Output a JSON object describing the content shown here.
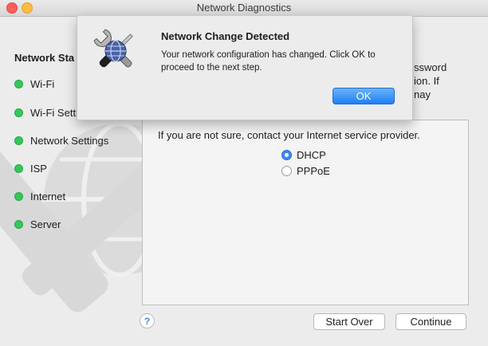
{
  "window": {
    "title": "Network Diagnostics"
  },
  "sidebar": {
    "heading": "Network Sta",
    "steps": [
      {
        "label": "Wi-Fi",
        "status": "green"
      },
      {
        "label": "Wi-Fi Setti",
        "status": "green"
      },
      {
        "label": "Network Settings",
        "status": "green"
      },
      {
        "label": "ISP",
        "status": "green"
      },
      {
        "label": "Internet",
        "status": "green"
      },
      {
        "label": "Server",
        "status": "green"
      }
    ]
  },
  "content": {
    "behind_alert_lines": [
      "ssword",
      "ion. If",
      "nay"
    ],
    "instruction": "If you are not sure, contact your Internet service provider.",
    "radio_options": [
      {
        "label": "DHCP",
        "selected": true
      },
      {
        "label": "PPPoE",
        "selected": false
      }
    ]
  },
  "footer": {
    "help_label": "?",
    "start_over_label": "Start Over",
    "continue_label": "Continue"
  },
  "alert": {
    "icon": "network-utility-icon",
    "title": "Network Change Detected",
    "message": "Your network configuration has changed. Click OK to proceed to the next step.",
    "ok_label": "OK"
  },
  "colors": {
    "accent": "#3b86f6",
    "status_green": "#34c759"
  }
}
